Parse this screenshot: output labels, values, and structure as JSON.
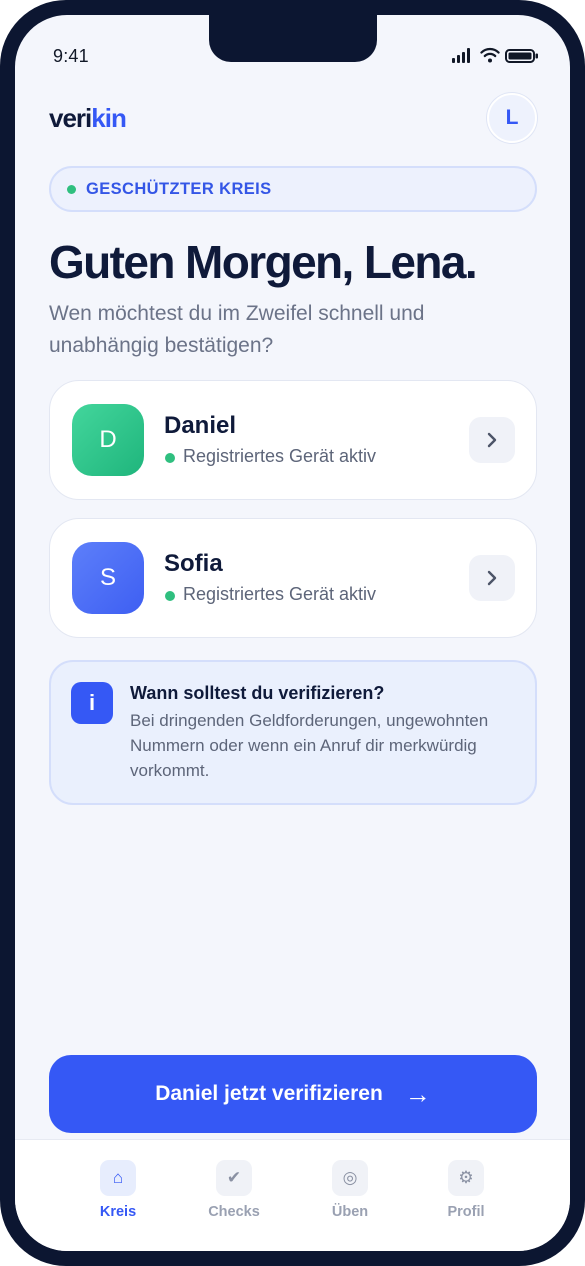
{
  "status_bar": {
    "time": "9:41"
  },
  "brand": {
    "logo_part1": "veri",
    "logo_part2": "kin",
    "avatar_initial": "L"
  },
  "badge": {
    "label": "GESCHÜTZTER KREIS"
  },
  "greeting": {
    "title": "Guten Morgen, Lena.",
    "subtitle": "Wen möchtest du im Zweifel schnell und unabhängig bestätigen?"
  },
  "contacts": [
    {
      "initial": "D",
      "name": "Daniel",
      "status": "Registriertes Gerät aktiv",
      "color": "#22c38a"
    },
    {
      "initial": "S",
      "name": "Sofia",
      "status": "Registriertes Gerät aktiv",
      "color": "#4a6cf7"
    }
  ],
  "info": {
    "icon": "i",
    "title": "Wann solltest du verifizieren?",
    "body": "Bei dringenden Geldforderungen, ungewohnten Nummern oder wenn ein Anruf dir merkwürdig vorkommt."
  },
  "cta": {
    "label": "Daniel jetzt verifizieren",
    "arrow": "→"
  },
  "tabs": [
    {
      "label": "Kreis",
      "icon": "home-icon",
      "glyph": "⌂",
      "active": true
    },
    {
      "label": "Checks",
      "icon": "check-icon",
      "glyph": "✔",
      "active": false
    },
    {
      "label": "Üben",
      "icon": "target-icon",
      "glyph": "◎",
      "active": false
    },
    {
      "label": "Profil",
      "icon": "gear-icon",
      "glyph": "⚙",
      "active": false
    }
  ],
  "colors": {
    "accent": "#3558f5",
    "success": "#2fbf7f",
    "text": "#0f1a3a",
    "frame": "#0c1631"
  }
}
